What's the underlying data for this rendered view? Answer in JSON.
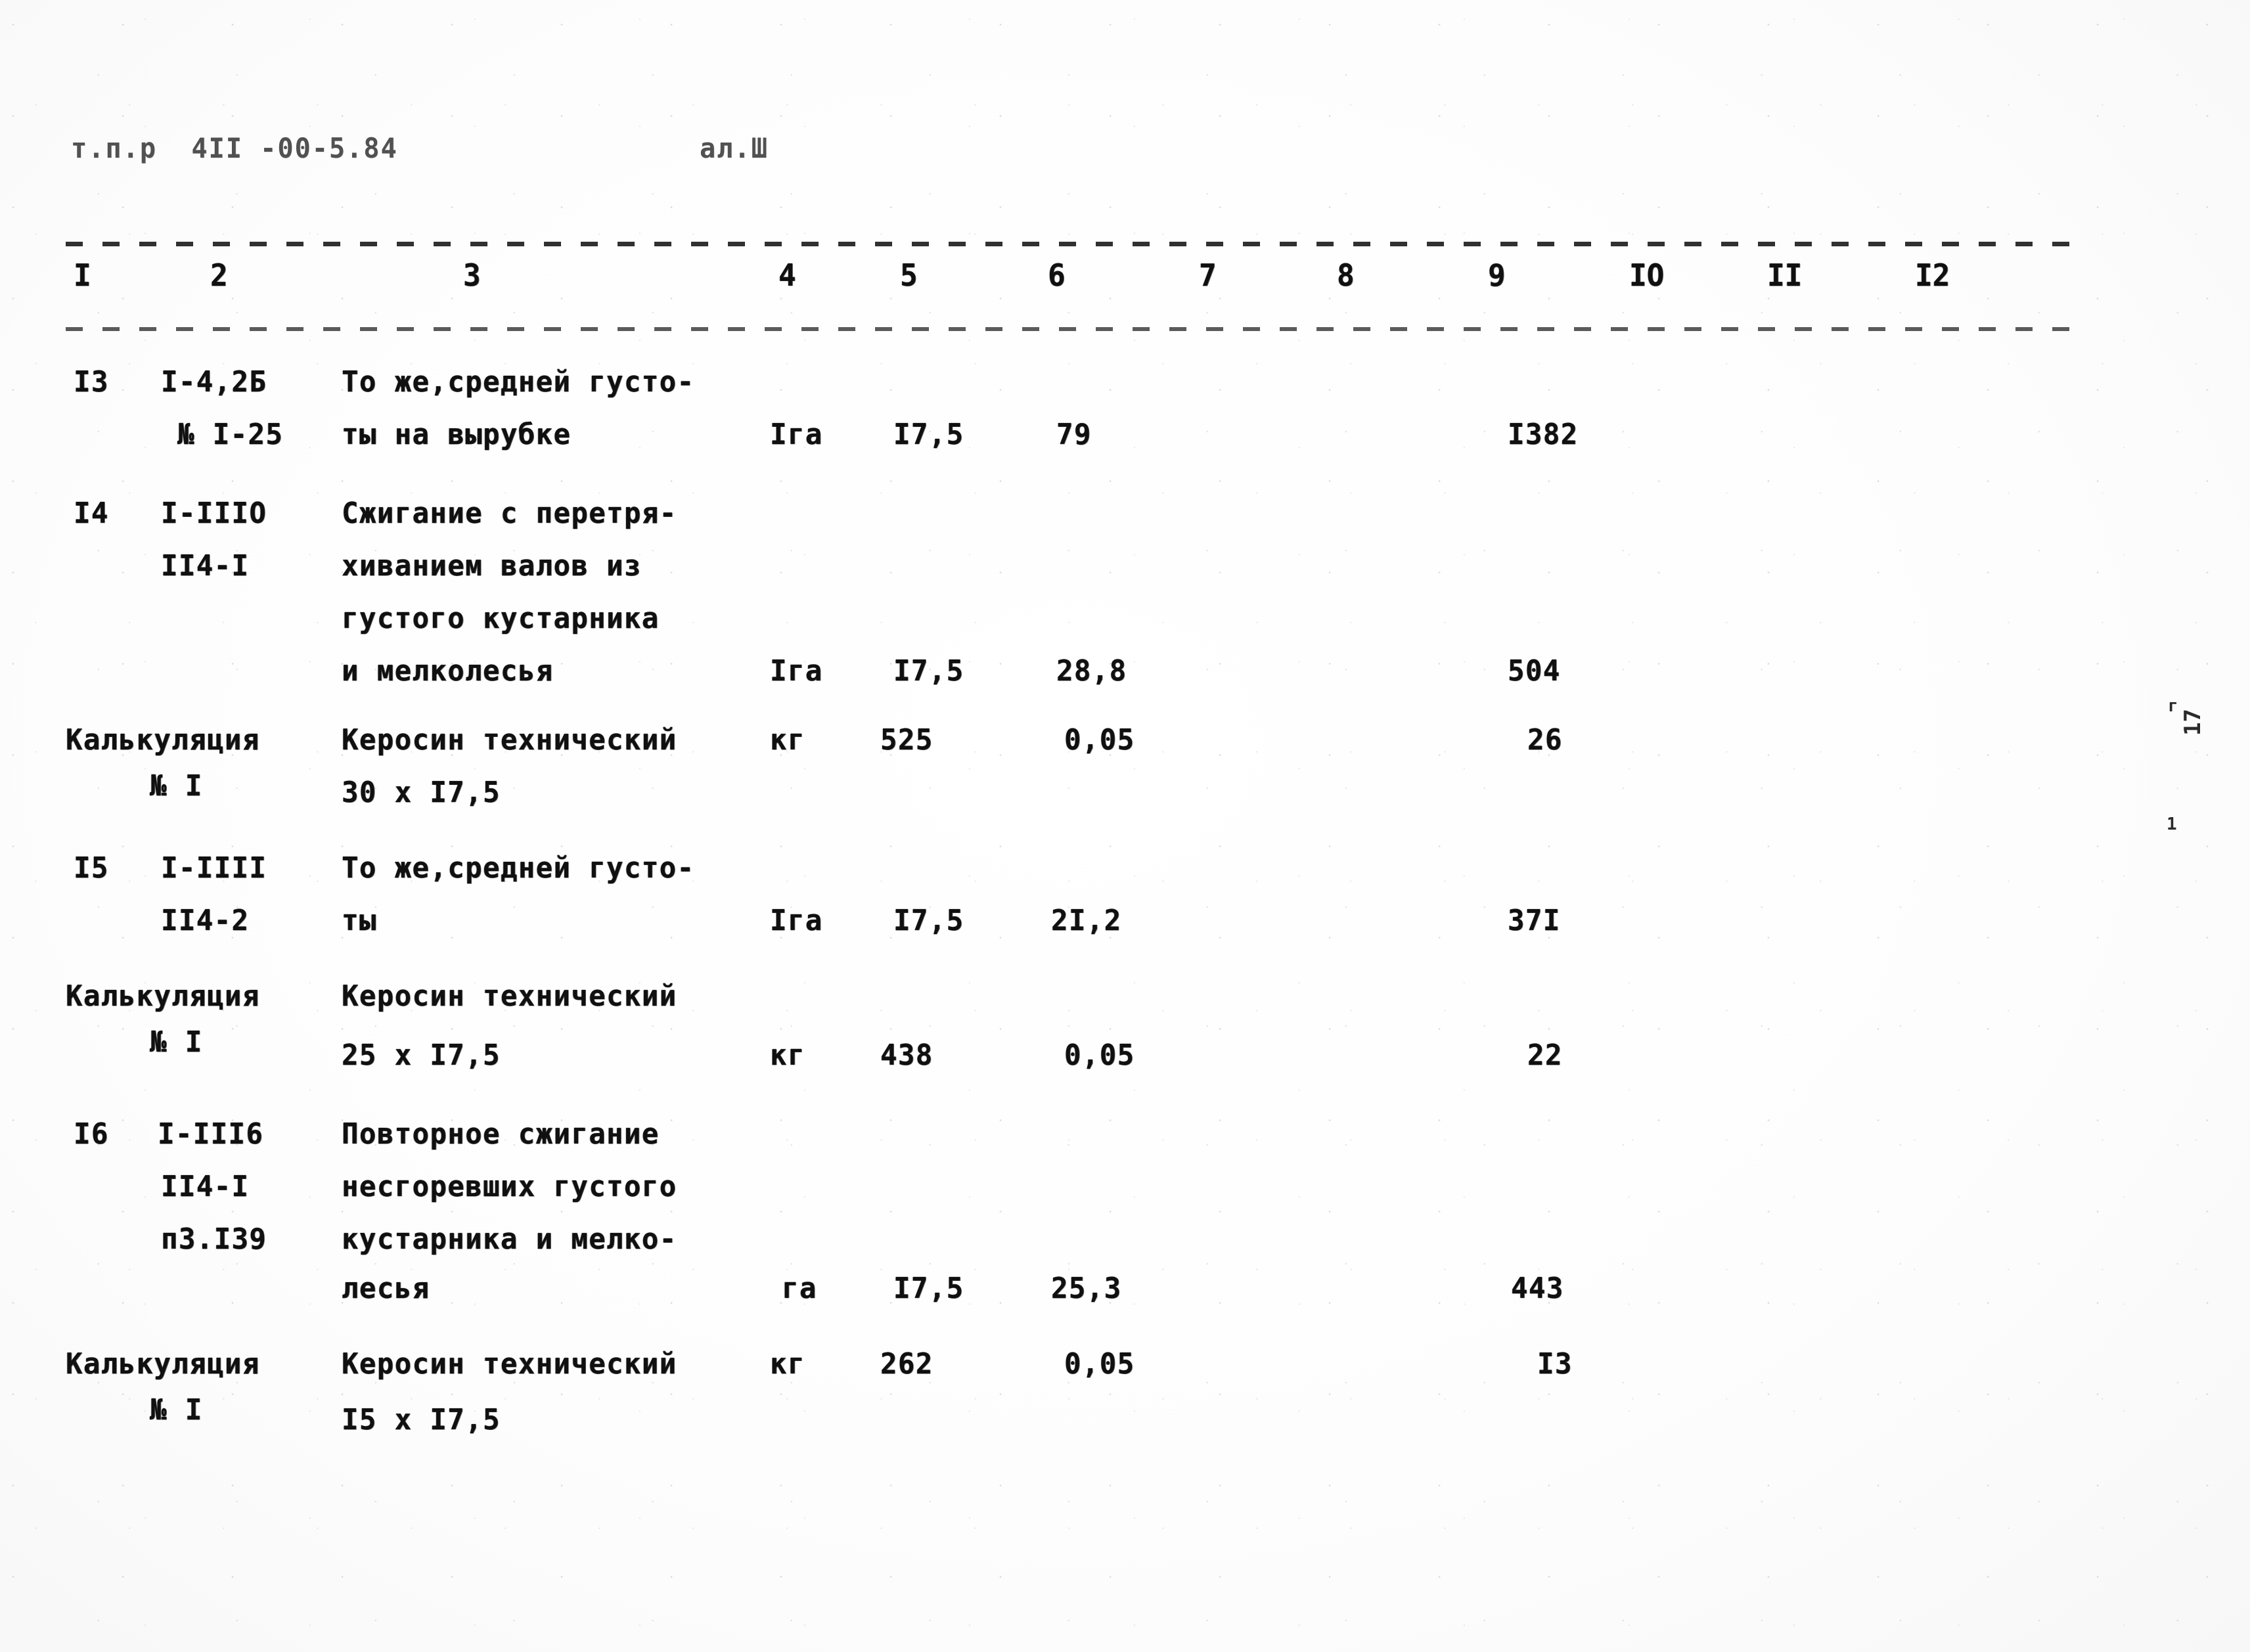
{
  "document": {
    "header_left": "т.п.р  4II -00-5.84",
    "header_right": "ал.Ш",
    "right_margin_marks": [
      "г",
      "17",
      "1"
    ]
  },
  "table": {
    "column_header_numbers": [
      "I",
      "2",
      "3",
      "4",
      "5",
      "6",
      "7",
      "8",
      "9",
      "IO",
      "II",
      "I2"
    ],
    "rows": [
      {
        "item_no": "I3",
        "code_lines": [
          "I-4,2Б",
          "№ I-25"
        ],
        "description_lines": [
          "То же,средней густо-",
          "ты на вырубке"
        ],
        "unit": "Iга",
        "qty": "I7,5",
        "price": "79",
        "total": "I382"
      },
      {
        "item_no": "I4",
        "code_lines": [
          "I-IIIO",
          "II4-I"
        ],
        "description_lines": [
          "Сжигание с перетря-",
          "хиванием валов из",
          "густого кустарника",
          "и мелколесья"
        ],
        "unit": "Iга",
        "qty": "I7,5",
        "price": "28,8",
        "total": "504"
      },
      {
        "item_no": "",
        "code_lines": [
          "Калькуляция",
          "№ I"
        ],
        "description_lines": [
          "Керосин технический",
          "30 х I7,5"
        ],
        "unit": "кг",
        "qty": "525",
        "price": "0,05",
        "total": "26"
      },
      {
        "item_no": "I5",
        "code_lines": [
          "I-IIII",
          "II4-2"
        ],
        "description_lines": [
          "То же,средней густо-",
          "ты"
        ],
        "unit": "Iга",
        "qty": "I7,5",
        "price": "2I,2",
        "total": "37I"
      },
      {
        "item_no": "",
        "code_lines": [
          "Калькуляция",
          "№ I"
        ],
        "description_lines": [
          "Керосин технический",
          "25 х I7,5"
        ],
        "unit": "кг",
        "qty": "438",
        "price": "0,05",
        "total": "22"
      },
      {
        "item_no": "I6",
        "code_lines": [
          "I-III6",
          "II4-I",
          "п3.I39"
        ],
        "description_lines": [
          "Повторное сжигание",
          "несгоревших густого",
          "кустарника и мелко-",
          "лесья"
        ],
        "unit": "га",
        "qty": "I7,5",
        "price": "25,3",
        "total": "443"
      },
      {
        "item_no": "",
        "code_lines": [
          "Калькуляция",
          "№ I"
        ],
        "description_lines": [
          "Керосин технический",
          "I5 х I7,5"
        ],
        "unit": "кг",
        "qty": "262",
        "price": "0,05",
        "total": "I3"
      }
    ]
  }
}
